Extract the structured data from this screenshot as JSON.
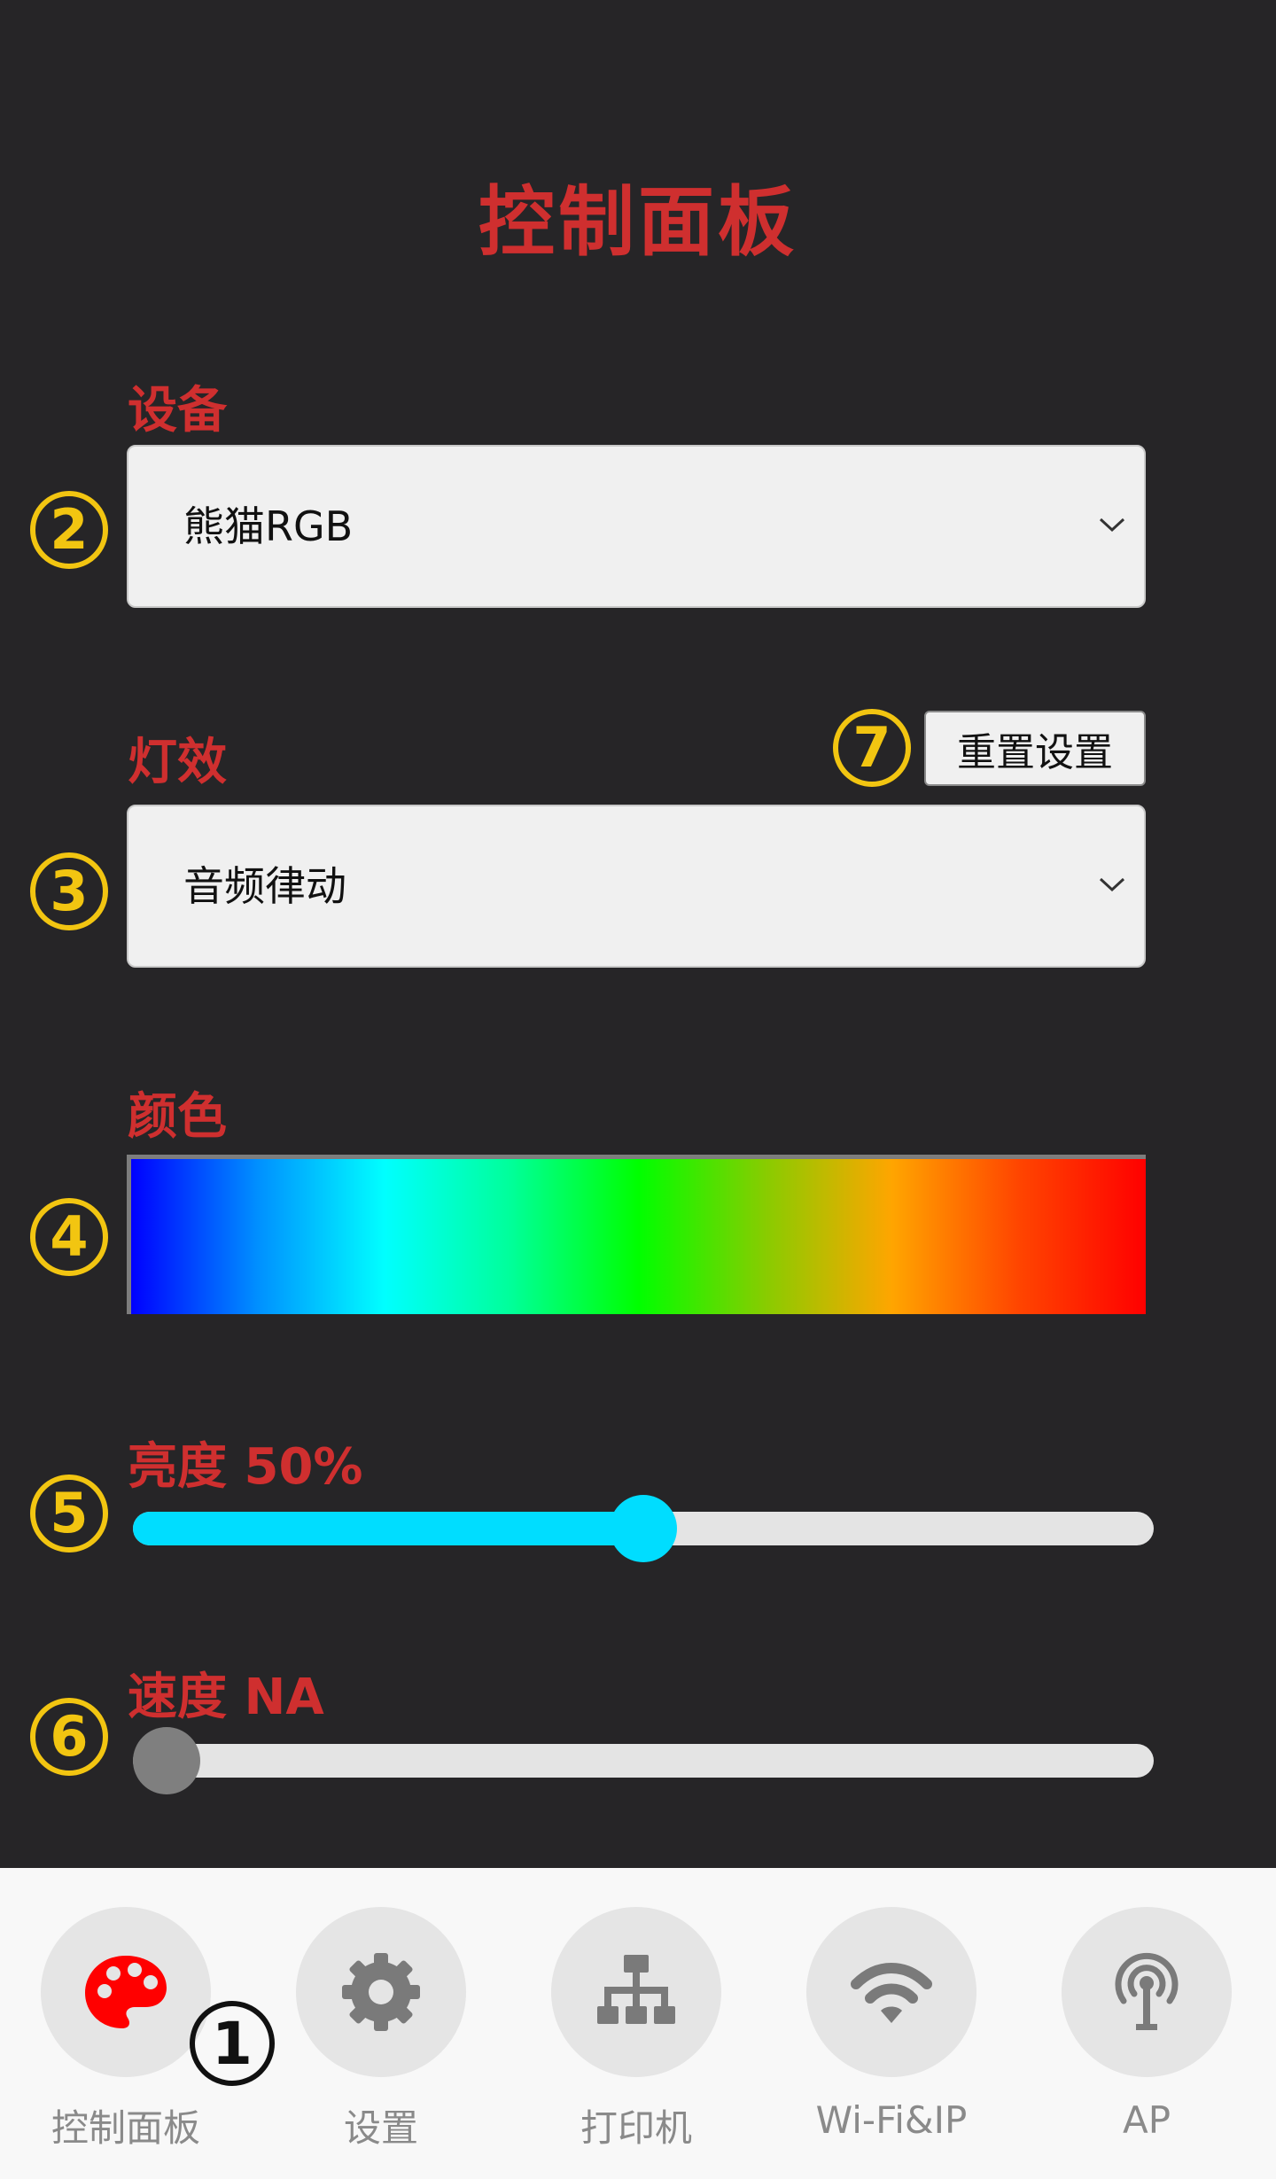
{
  "page_title": "控制面板",
  "device": {
    "label": "设备",
    "selected": "熊猫RGB"
  },
  "effect": {
    "label": "灯效",
    "selected": "音频律动",
    "reset_label": "重置设置"
  },
  "color": {
    "label": "颜色",
    "gradient": [
      "#0000ff",
      "#0090ff",
      "#00ffff",
      "#00ff99",
      "#00ff00",
      "#88cc00",
      "#ffa500",
      "#ff4500",
      "#ff0000"
    ]
  },
  "brightness": {
    "label": "亮度 50%",
    "value_percent": 50,
    "fill_color": "#00ddff"
  },
  "speed": {
    "label": "速度 NA",
    "value_percent": 0,
    "thumb_color": "#7f7f7f"
  },
  "markers": {
    "m1": "1",
    "m2": "2",
    "m3": "3",
    "m4": "4",
    "m5": "5",
    "m6": "6",
    "m7": "7"
  },
  "bottom_nav": [
    {
      "label": "控制面板",
      "icon": "palette-icon",
      "active": true
    },
    {
      "label": "设置",
      "icon": "gear-icon"
    },
    {
      "label": "打印机",
      "icon": "network-icon"
    },
    {
      "label": "Wi-Fi&IP",
      "icon": "wifi-icon"
    },
    {
      "label": "AP",
      "icon": "antenna-icon"
    }
  ],
  "colors": {
    "accent": "#cf2f2f",
    "marker": "#f2c511",
    "background": "#262527",
    "active_icon": "#ff0000"
  }
}
